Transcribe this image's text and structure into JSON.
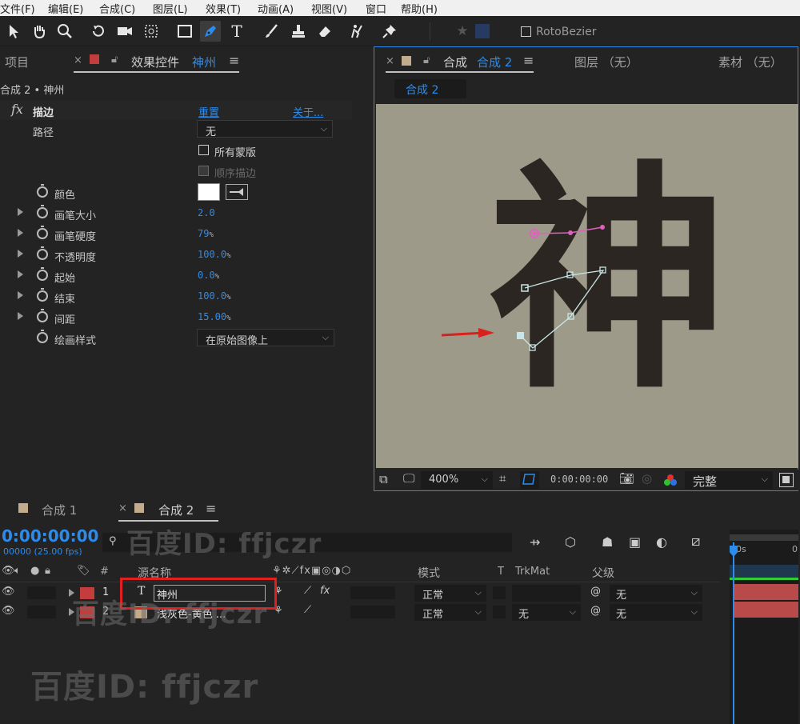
{
  "menu": [
    "文件(F)",
    "编辑(E)",
    "合成(C)",
    "图层(L)",
    "效果(T)",
    "动画(A)",
    "视图(V)",
    "窗口",
    "帮助(H)"
  ],
  "toolbar": {
    "rotobezier": "RotoBezier"
  },
  "left_tabs": {
    "project": "项目",
    "effects_prefix": "效果控件",
    "effects_layer": "神州"
  },
  "breadcrumb": "合成 2 • 神州",
  "effect": {
    "fx": "fx",
    "name": "描边",
    "reset": "重置",
    "about": "关于...",
    "path_label": "路径",
    "path_value": "无",
    "all_masks": "所有蒙版",
    "sequential": "顺序描边",
    "color_label": "颜色",
    "props": [
      {
        "label": "画笔大小",
        "value": "2.0",
        "unit": ""
      },
      {
        "label": "画笔硬度",
        "value": "79",
        "unit": "%"
      },
      {
        "label": "不透明度",
        "value": "100.0",
        "unit": "%"
      },
      {
        "label": "起始",
        "value": "0.0",
        "unit": "%"
      },
      {
        "label": "结束",
        "value": "100.0",
        "unit": "%"
      },
      {
        "label": "间距",
        "value": "15.00",
        "unit": "%"
      }
    ],
    "paint_style_label": "绘画样式",
    "paint_style_value": "在原始图像上"
  },
  "viewer": {
    "tab_prefix": "合成",
    "tab_comp": "合成 2",
    "layer_tab": "图层 （无）",
    "footage_tab": "素材 （无）",
    "comp_chip": "合成 2",
    "character": "神",
    "zoom": "400%",
    "timecode": "0:00:00:00",
    "quality": "完整"
  },
  "timeline": {
    "tab1": "合成 1",
    "tab2": "合成 2",
    "timecode": "0:00:00:00",
    "fps": "00000 (25.00 fps)",
    "cols": {
      "num": "#",
      "source": "源名称",
      "mode": "模式",
      "t": "T",
      "trkmat": "TrkMat",
      "parent": "父级"
    },
    "layers": [
      {
        "num": "1",
        "type": "T",
        "name": "神州",
        "mode": "正常",
        "trkmat": "",
        "parent": "无"
      },
      {
        "num": "2",
        "type": "",
        "name": "浅灰色-黄色 ...",
        "mode": "正常",
        "trkmat": "无",
        "parent": "无"
      }
    ],
    "ruler_0": "0s",
    "ruler_end": "0"
  },
  "watermarks": [
    "百度ID: ffjczr",
    "百度ID: ffjczr",
    "百度ID: ffjczr"
  ],
  "colors": {
    "accent": "#2d8ceb",
    "layer_red": "#c43d3d",
    "selection": "#e02020",
    "canvas": "#9e9a8a"
  }
}
